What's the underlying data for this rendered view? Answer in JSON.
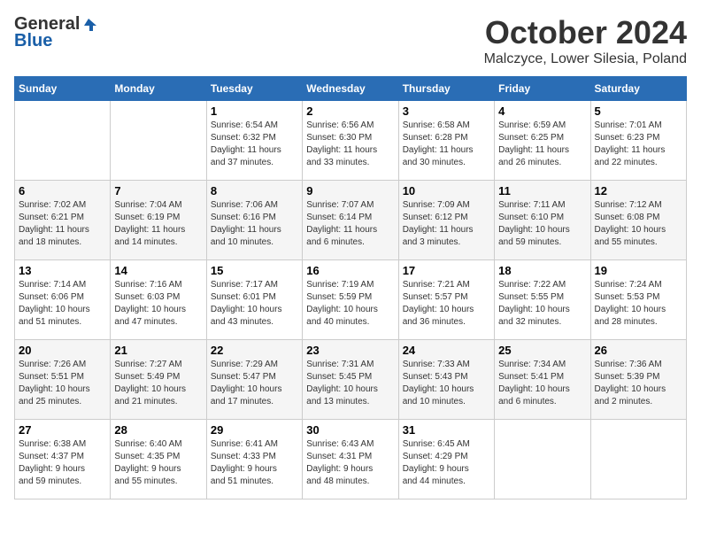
{
  "header": {
    "logo_general": "General",
    "logo_blue": "Blue",
    "title": "October 2024",
    "location": "Malczyce, Lower Silesia, Poland"
  },
  "weekdays": [
    "Sunday",
    "Monday",
    "Tuesday",
    "Wednesday",
    "Thursday",
    "Friday",
    "Saturday"
  ],
  "weeks": [
    [
      {
        "day": "",
        "info": ""
      },
      {
        "day": "",
        "info": ""
      },
      {
        "day": "1",
        "info": "Sunrise: 6:54 AM\nSunset: 6:32 PM\nDaylight: 11 hours\nand 37 minutes."
      },
      {
        "day": "2",
        "info": "Sunrise: 6:56 AM\nSunset: 6:30 PM\nDaylight: 11 hours\nand 33 minutes."
      },
      {
        "day": "3",
        "info": "Sunrise: 6:58 AM\nSunset: 6:28 PM\nDaylight: 11 hours\nand 30 minutes."
      },
      {
        "day": "4",
        "info": "Sunrise: 6:59 AM\nSunset: 6:25 PM\nDaylight: 11 hours\nand 26 minutes."
      },
      {
        "day": "5",
        "info": "Sunrise: 7:01 AM\nSunset: 6:23 PM\nDaylight: 11 hours\nand 22 minutes."
      }
    ],
    [
      {
        "day": "6",
        "info": "Sunrise: 7:02 AM\nSunset: 6:21 PM\nDaylight: 11 hours\nand 18 minutes."
      },
      {
        "day": "7",
        "info": "Sunrise: 7:04 AM\nSunset: 6:19 PM\nDaylight: 11 hours\nand 14 minutes."
      },
      {
        "day": "8",
        "info": "Sunrise: 7:06 AM\nSunset: 6:16 PM\nDaylight: 11 hours\nand 10 minutes."
      },
      {
        "day": "9",
        "info": "Sunrise: 7:07 AM\nSunset: 6:14 PM\nDaylight: 11 hours\nand 6 minutes."
      },
      {
        "day": "10",
        "info": "Sunrise: 7:09 AM\nSunset: 6:12 PM\nDaylight: 11 hours\nand 3 minutes."
      },
      {
        "day": "11",
        "info": "Sunrise: 7:11 AM\nSunset: 6:10 PM\nDaylight: 10 hours\nand 59 minutes."
      },
      {
        "day": "12",
        "info": "Sunrise: 7:12 AM\nSunset: 6:08 PM\nDaylight: 10 hours\nand 55 minutes."
      }
    ],
    [
      {
        "day": "13",
        "info": "Sunrise: 7:14 AM\nSunset: 6:06 PM\nDaylight: 10 hours\nand 51 minutes."
      },
      {
        "day": "14",
        "info": "Sunrise: 7:16 AM\nSunset: 6:03 PM\nDaylight: 10 hours\nand 47 minutes."
      },
      {
        "day": "15",
        "info": "Sunrise: 7:17 AM\nSunset: 6:01 PM\nDaylight: 10 hours\nand 43 minutes."
      },
      {
        "day": "16",
        "info": "Sunrise: 7:19 AM\nSunset: 5:59 PM\nDaylight: 10 hours\nand 40 minutes."
      },
      {
        "day": "17",
        "info": "Sunrise: 7:21 AM\nSunset: 5:57 PM\nDaylight: 10 hours\nand 36 minutes."
      },
      {
        "day": "18",
        "info": "Sunrise: 7:22 AM\nSunset: 5:55 PM\nDaylight: 10 hours\nand 32 minutes."
      },
      {
        "day": "19",
        "info": "Sunrise: 7:24 AM\nSunset: 5:53 PM\nDaylight: 10 hours\nand 28 minutes."
      }
    ],
    [
      {
        "day": "20",
        "info": "Sunrise: 7:26 AM\nSunset: 5:51 PM\nDaylight: 10 hours\nand 25 minutes."
      },
      {
        "day": "21",
        "info": "Sunrise: 7:27 AM\nSunset: 5:49 PM\nDaylight: 10 hours\nand 21 minutes."
      },
      {
        "day": "22",
        "info": "Sunrise: 7:29 AM\nSunset: 5:47 PM\nDaylight: 10 hours\nand 17 minutes."
      },
      {
        "day": "23",
        "info": "Sunrise: 7:31 AM\nSunset: 5:45 PM\nDaylight: 10 hours\nand 13 minutes."
      },
      {
        "day": "24",
        "info": "Sunrise: 7:33 AM\nSunset: 5:43 PM\nDaylight: 10 hours\nand 10 minutes."
      },
      {
        "day": "25",
        "info": "Sunrise: 7:34 AM\nSunset: 5:41 PM\nDaylight: 10 hours\nand 6 minutes."
      },
      {
        "day": "26",
        "info": "Sunrise: 7:36 AM\nSunset: 5:39 PM\nDaylight: 10 hours\nand 2 minutes."
      }
    ],
    [
      {
        "day": "27",
        "info": "Sunrise: 6:38 AM\nSunset: 4:37 PM\nDaylight: 9 hours\nand 59 minutes."
      },
      {
        "day": "28",
        "info": "Sunrise: 6:40 AM\nSunset: 4:35 PM\nDaylight: 9 hours\nand 55 minutes."
      },
      {
        "day": "29",
        "info": "Sunrise: 6:41 AM\nSunset: 4:33 PM\nDaylight: 9 hours\nand 51 minutes."
      },
      {
        "day": "30",
        "info": "Sunrise: 6:43 AM\nSunset: 4:31 PM\nDaylight: 9 hours\nand 48 minutes."
      },
      {
        "day": "31",
        "info": "Sunrise: 6:45 AM\nSunset: 4:29 PM\nDaylight: 9 hours\nand 44 minutes."
      },
      {
        "day": "",
        "info": ""
      },
      {
        "day": "",
        "info": ""
      }
    ]
  ]
}
